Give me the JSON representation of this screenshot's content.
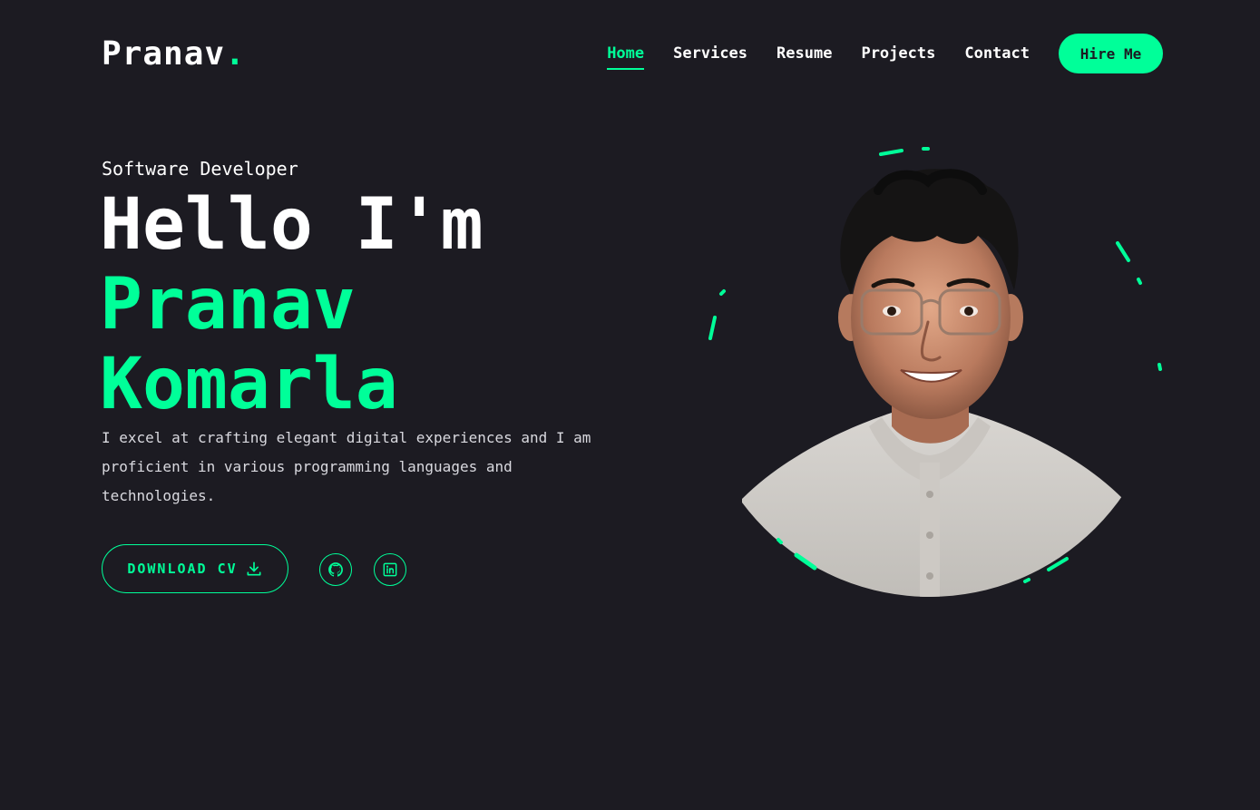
{
  "header": {
    "logo_text": "Pranav",
    "logo_dot": ".",
    "nav": [
      {
        "label": "Home",
        "active": true
      },
      {
        "label": "Services",
        "active": false
      },
      {
        "label": "Resume",
        "active": false
      },
      {
        "label": "Projects",
        "active": false
      },
      {
        "label": "Contact",
        "active": false
      }
    ],
    "hire_label": "Hire Me"
  },
  "hero": {
    "role": "Software Developer",
    "greeting": "Hello I'm",
    "first_name": "Pranav",
    "last_name": "Komarla",
    "description": "I excel at crafting elegant digital experiences and I am proficient in various programming languages and technologies.",
    "cv_label": "DOWNLOAD CV",
    "cv_icon": "download-icon",
    "socials": [
      {
        "icon": "github-icon"
      },
      {
        "icon": "linkedin-icon"
      }
    ]
  },
  "colors": {
    "background": "#1c1b22",
    "accent": "#00ff99",
    "text": "#ffffff"
  }
}
